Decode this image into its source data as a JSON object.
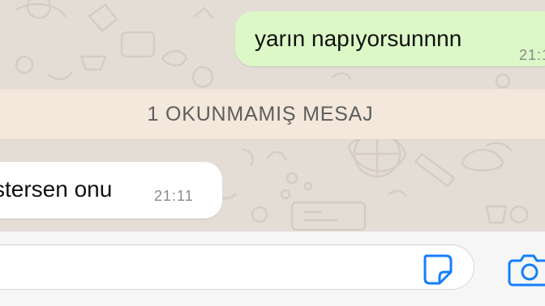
{
  "chat": {
    "outgoing_message": {
      "text": "yarın napıyorsunnnn",
      "time": "21:1"
    },
    "unread_divider": {
      "label": "1 OKUNMAMIŞ MESAJ"
    },
    "incoming_message": {
      "text": "stersen onu",
      "time": "21:11"
    }
  },
  "composer": {
    "placeholder": "",
    "sticker_icon": "sticker-icon",
    "camera_icon": "camera-icon"
  },
  "colors": {
    "chat_background": "#e4ddd5",
    "outgoing_bubble": "#dcf8c6",
    "incoming_bubble": "#ffffff",
    "unread_bar": "#f4e9dc",
    "accent_blue": "#147efb"
  }
}
